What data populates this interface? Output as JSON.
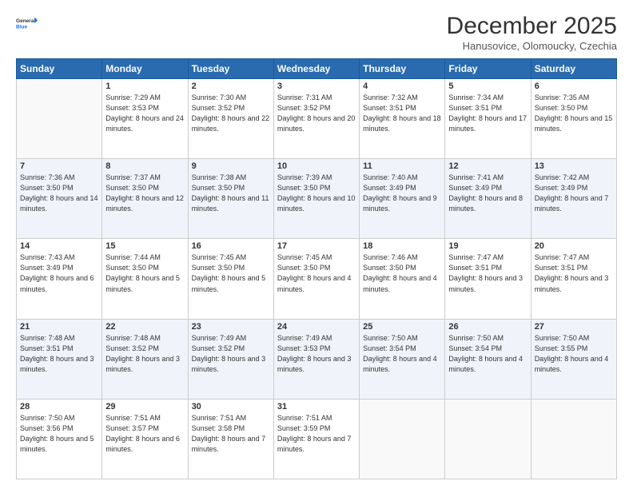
{
  "logo": {
    "line1": "General",
    "line2": "Blue"
  },
  "title": "December 2025",
  "location": "Hanusovice, Olomoucky, Czechia",
  "days_header": [
    "Sunday",
    "Monday",
    "Tuesday",
    "Wednesday",
    "Thursday",
    "Friday",
    "Saturday"
  ],
  "weeks": [
    [
      {
        "day": "",
        "empty": true
      },
      {
        "day": "1",
        "sunrise": "7:29 AM",
        "sunset": "3:53 PM",
        "daylight": "8 hours and 24 minutes."
      },
      {
        "day": "2",
        "sunrise": "7:30 AM",
        "sunset": "3:52 PM",
        "daylight": "8 hours and 22 minutes."
      },
      {
        "day": "3",
        "sunrise": "7:31 AM",
        "sunset": "3:52 PM",
        "daylight": "8 hours and 20 minutes."
      },
      {
        "day": "4",
        "sunrise": "7:32 AM",
        "sunset": "3:51 PM",
        "daylight": "8 hours and 18 minutes."
      },
      {
        "day": "5",
        "sunrise": "7:34 AM",
        "sunset": "3:51 PM",
        "daylight": "8 hours and 17 minutes."
      },
      {
        "day": "6",
        "sunrise": "7:35 AM",
        "sunset": "3:50 PM",
        "daylight": "8 hours and 15 minutes."
      }
    ],
    [
      {
        "day": "7",
        "sunrise": "7:36 AM",
        "sunset": "3:50 PM",
        "daylight": "8 hours and 14 minutes."
      },
      {
        "day": "8",
        "sunrise": "7:37 AM",
        "sunset": "3:50 PM",
        "daylight": "8 hours and 12 minutes."
      },
      {
        "day": "9",
        "sunrise": "7:38 AM",
        "sunset": "3:50 PM",
        "daylight": "8 hours and 11 minutes."
      },
      {
        "day": "10",
        "sunrise": "7:39 AM",
        "sunset": "3:50 PM",
        "daylight": "8 hours and 10 minutes."
      },
      {
        "day": "11",
        "sunrise": "7:40 AM",
        "sunset": "3:49 PM",
        "daylight": "8 hours and 9 minutes."
      },
      {
        "day": "12",
        "sunrise": "7:41 AM",
        "sunset": "3:49 PM",
        "daylight": "8 hours and 8 minutes."
      },
      {
        "day": "13",
        "sunrise": "7:42 AM",
        "sunset": "3:49 PM",
        "daylight": "8 hours and 7 minutes."
      }
    ],
    [
      {
        "day": "14",
        "sunrise": "7:43 AM",
        "sunset": "3:49 PM",
        "daylight": "8 hours and 6 minutes."
      },
      {
        "day": "15",
        "sunrise": "7:44 AM",
        "sunset": "3:50 PM",
        "daylight": "8 hours and 5 minutes."
      },
      {
        "day": "16",
        "sunrise": "7:45 AM",
        "sunset": "3:50 PM",
        "daylight": "8 hours and 5 minutes."
      },
      {
        "day": "17",
        "sunrise": "7:45 AM",
        "sunset": "3:50 PM",
        "daylight": "8 hours and 4 minutes."
      },
      {
        "day": "18",
        "sunrise": "7:46 AM",
        "sunset": "3:50 PM",
        "daylight": "8 hours and 4 minutes."
      },
      {
        "day": "19",
        "sunrise": "7:47 AM",
        "sunset": "3:51 PM",
        "daylight": "8 hours and 3 minutes."
      },
      {
        "day": "20",
        "sunrise": "7:47 AM",
        "sunset": "3:51 PM",
        "daylight": "8 hours and 3 minutes."
      }
    ],
    [
      {
        "day": "21",
        "sunrise": "7:48 AM",
        "sunset": "3:51 PM",
        "daylight": "8 hours and 3 minutes."
      },
      {
        "day": "22",
        "sunrise": "7:48 AM",
        "sunset": "3:52 PM",
        "daylight": "8 hours and 3 minutes."
      },
      {
        "day": "23",
        "sunrise": "7:49 AM",
        "sunset": "3:52 PM",
        "daylight": "8 hours and 3 minutes."
      },
      {
        "day": "24",
        "sunrise": "7:49 AM",
        "sunset": "3:53 PM",
        "daylight": "8 hours and 3 minutes."
      },
      {
        "day": "25",
        "sunrise": "7:50 AM",
        "sunset": "3:54 PM",
        "daylight": "8 hours and 4 minutes."
      },
      {
        "day": "26",
        "sunrise": "7:50 AM",
        "sunset": "3:54 PM",
        "daylight": "8 hours and 4 minutes."
      },
      {
        "day": "27",
        "sunrise": "7:50 AM",
        "sunset": "3:55 PM",
        "daylight": "8 hours and 4 minutes."
      }
    ],
    [
      {
        "day": "28",
        "sunrise": "7:50 AM",
        "sunset": "3:56 PM",
        "daylight": "8 hours and 5 minutes."
      },
      {
        "day": "29",
        "sunrise": "7:51 AM",
        "sunset": "3:57 PM",
        "daylight": "8 hours and 6 minutes."
      },
      {
        "day": "30",
        "sunrise": "7:51 AM",
        "sunset": "3:58 PM",
        "daylight": "8 hours and 7 minutes."
      },
      {
        "day": "31",
        "sunrise": "7:51 AM",
        "sunset": "3:59 PM",
        "daylight": "8 hours and 7 minutes."
      },
      {
        "day": "",
        "empty": true
      },
      {
        "day": "",
        "empty": true
      },
      {
        "day": "",
        "empty": true
      }
    ]
  ]
}
